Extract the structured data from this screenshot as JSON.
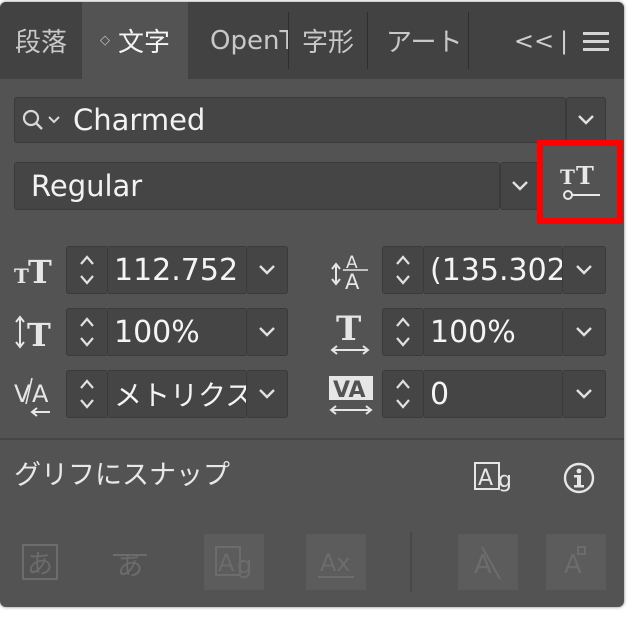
{
  "tabs": [
    {
      "label": "段落",
      "active": false
    },
    {
      "label": "文字",
      "active": true
    },
    {
      "label": "OpenT",
      "active": false
    },
    {
      "label": "字形",
      "active": false
    },
    {
      "label": "アート",
      "active": false
    }
  ],
  "tab_icons": {
    "collapse": "<<",
    "divider": "|",
    "menu": "hamburger-icon"
  },
  "font_family": {
    "value": "Charmed"
  },
  "font_style": {
    "value": "Regular"
  },
  "fields": {
    "font_size": {
      "value": "112.752",
      "icon": "font-size-icon"
    },
    "leading": {
      "value": "(135.302",
      "icon": "leading-icon"
    },
    "vertical_scale": {
      "value": "100%",
      "icon": "vertical-scale-icon"
    },
    "horizontal_scale": {
      "value": "100%",
      "icon": "horizontal-scale-icon"
    },
    "kerning": {
      "value": "メトリクス",
      "icon": "kerning-icon"
    },
    "tracking": {
      "value": "0",
      "icon": "tracking-icon"
    }
  },
  "snap": {
    "label": "グリフにスナップ"
  },
  "colors": {
    "panel": "#535353",
    "tabbar": "#424242",
    "field": "#454545",
    "highlight": "#ff0000"
  }
}
